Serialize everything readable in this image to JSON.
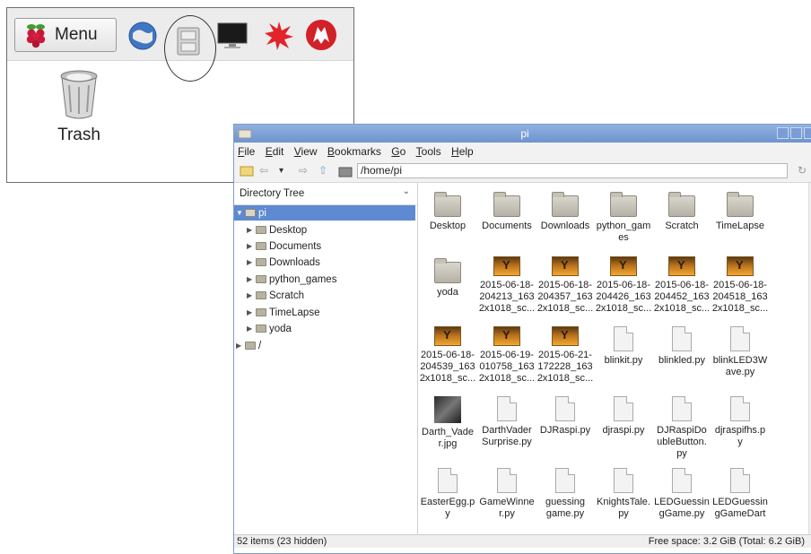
{
  "desktop": {
    "menu_label": "Menu",
    "trash_label": "Trash"
  },
  "window": {
    "title": "pi",
    "menus": [
      "File",
      "Edit",
      "View",
      "Bookmarks",
      "Go",
      "Tools",
      "Help"
    ],
    "path": "/home/pi"
  },
  "sidebar": {
    "header": "Directory Tree",
    "root": "pi",
    "children": [
      "Desktop",
      "Documents",
      "Downloads",
      "python_games",
      "Scratch",
      "TimeLapse",
      "yoda"
    ],
    "fs_root": "/"
  },
  "files": [
    {
      "name": "Desktop",
      "type": "folder"
    },
    {
      "name": "Documents",
      "type": "folder"
    },
    {
      "name": "Downloads",
      "type": "folder"
    },
    {
      "name": "python_gam\nes",
      "type": "folder"
    },
    {
      "name": "Scratch",
      "type": "folder"
    },
    {
      "name": "TimeLapse",
      "type": "folder"
    },
    {
      "name": "yoda",
      "type": "folder"
    },
    {
      "name": "2015-06-18-\n204213_163\n2x1018_sc...",
      "type": "image"
    },
    {
      "name": "2015-06-18-\n204357_163\n2x1018_sc...",
      "type": "image"
    },
    {
      "name": "2015-06-18-\n204426_163\n2x1018_sc...",
      "type": "image"
    },
    {
      "name": "2015-06-18-\n204452_163\n2x1018_sc...",
      "type": "image"
    },
    {
      "name": "2015-06-18-\n204518_163\n2x1018_sc...",
      "type": "image"
    },
    {
      "name": "2015-06-18-\n204539_163\n2x1018_sc...",
      "type": "image"
    },
    {
      "name": "2015-06-19-\n010758_163\n2x1018_sc...",
      "type": "image"
    },
    {
      "name": "2015-06-21-\n172228_163\n2x1018_sc...",
      "type": "image"
    },
    {
      "name": "blinkit.py",
      "type": "doc"
    },
    {
      "name": "blinkled.py",
      "type": "doc"
    },
    {
      "name": "blinkLED3W\nave.py",
      "type": "doc"
    },
    {
      "name": "Darth_Vade\nr.jpg",
      "type": "photo"
    },
    {
      "name": "DarthVader\nSurprise.py",
      "type": "doc"
    },
    {
      "name": "DJRaspi.py",
      "type": "doc"
    },
    {
      "name": "djraspi.py",
      "type": "doc"
    },
    {
      "name": "DJRaspiDo\nubleButton.\npy",
      "type": "doc"
    },
    {
      "name": "djraspifhs.p\ny",
      "type": "doc"
    },
    {
      "name": "EasterEgg.p\ny",
      "type": "doc"
    },
    {
      "name": "GameWinne\nr.py",
      "type": "doc"
    },
    {
      "name": "guessing\ngame.py",
      "type": "doc"
    },
    {
      "name": "KnightsTale.\npy",
      "type": "doc"
    },
    {
      "name": "LEDGuessin\ngGame.py",
      "type": "doc"
    },
    {
      "name": "LEDGuessin\ngGameDart",
      "type": "doc"
    }
  ],
  "status": {
    "left": "52 items (23 hidden)",
    "right": "Free space: 3.2 GiB (Total: 6.2 GiB)"
  }
}
